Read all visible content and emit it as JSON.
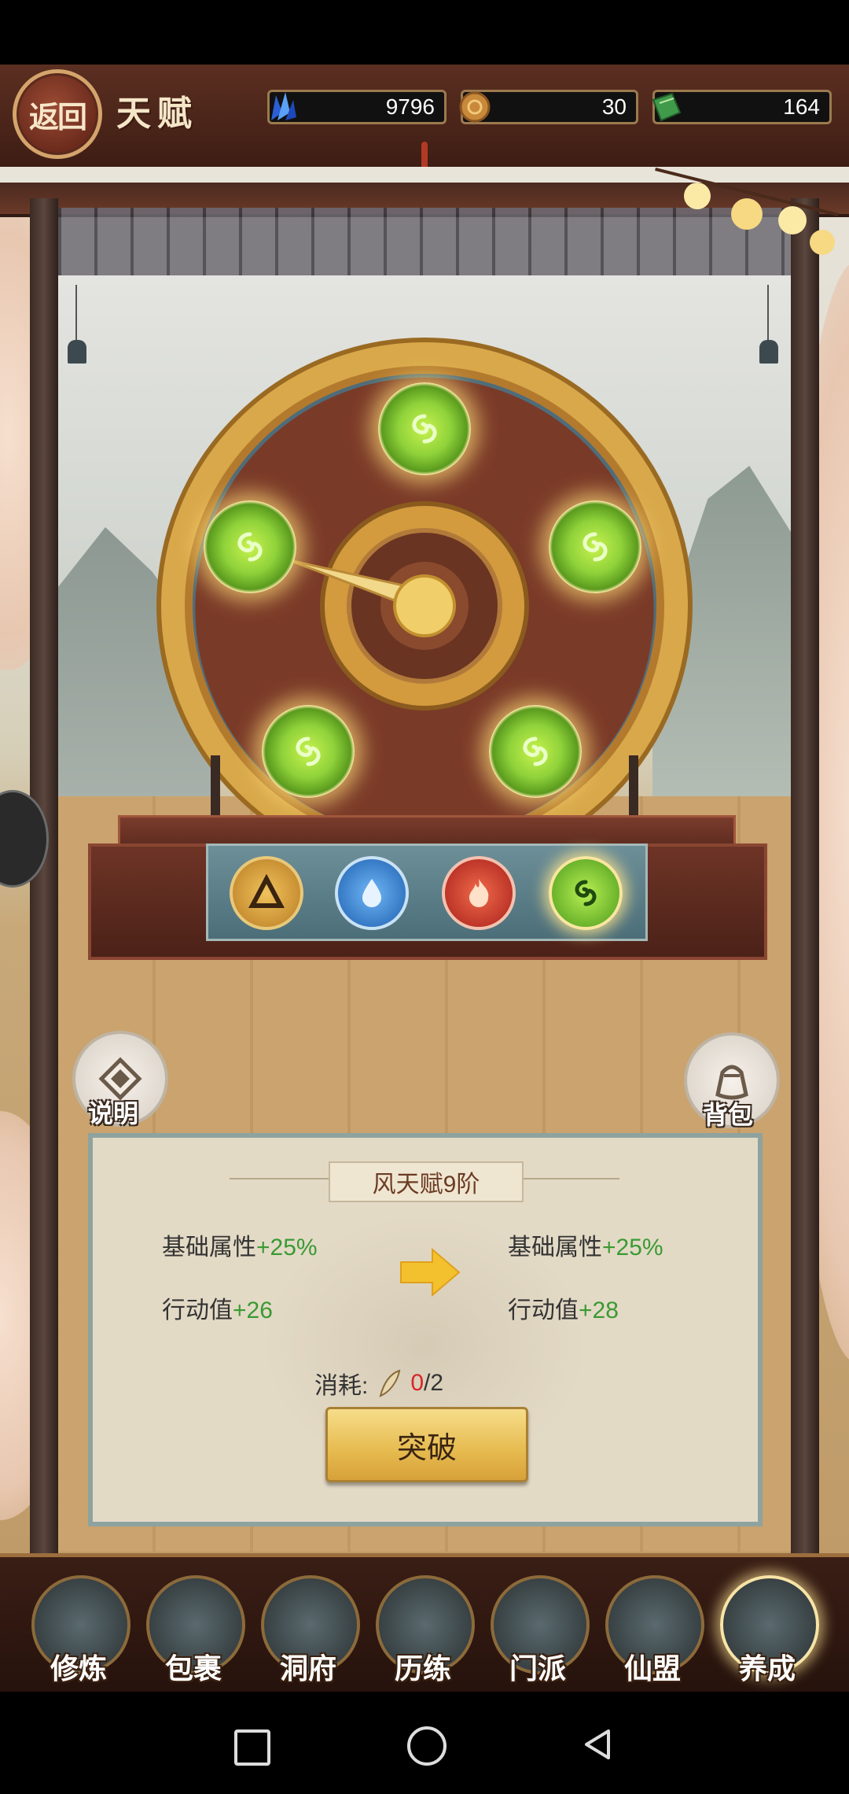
{
  "header": {
    "back_label": "返回",
    "title": "天赋",
    "resources": [
      {
        "icon": "blue-crystal-icon",
        "value": "9796"
      },
      {
        "icon": "copper-coin-icon",
        "value": "30"
      },
      {
        "icon": "green-book-icon",
        "value": "164"
      }
    ]
  },
  "wheel": {
    "slots": [
      "wind-element-icon",
      "wind-element-icon",
      "wind-element-icon",
      "wind-element-icon",
      "wind-element-icon"
    ],
    "elements": [
      {
        "name": "earth-element-icon",
        "color": "#d9a13a"
      },
      {
        "name": "water-element-icon",
        "color": "#3a8fe0"
      },
      {
        "name": "fire-element-icon",
        "color": "#d63a2a"
      },
      {
        "name": "wind-element-icon",
        "color": "#7cc83a"
      }
    ]
  },
  "side_buttons": {
    "help_label": "说明",
    "bag_label": "背包"
  },
  "panel": {
    "title": "风天赋9阶",
    "current": {
      "stat1_label": "基础属性",
      "stat1_value": "+25%",
      "stat2_label": "行动值",
      "stat2_value": "+26"
    },
    "next": {
      "stat1_label": "基础属性",
      "stat1_value": "+25%",
      "stat2_label": "行动值",
      "stat2_value": "+28"
    },
    "cost_label": "消耗:",
    "cost_have": "0",
    "cost_need": "/2",
    "button_label": "突破"
  },
  "nav": [
    {
      "label": "修炼",
      "active": false
    },
    {
      "label": "包裹",
      "active": false
    },
    {
      "label": "洞府",
      "active": false
    },
    {
      "label": "历练",
      "active": false
    },
    {
      "label": "门派",
      "active": false
    },
    {
      "label": "仙盟",
      "active": false
    },
    {
      "label": "养成",
      "active": true
    }
  ],
  "colors": {
    "accent_green": "#3a9a33",
    "cost_red": "#d8262a",
    "frame_brown": "#5b2f21"
  }
}
